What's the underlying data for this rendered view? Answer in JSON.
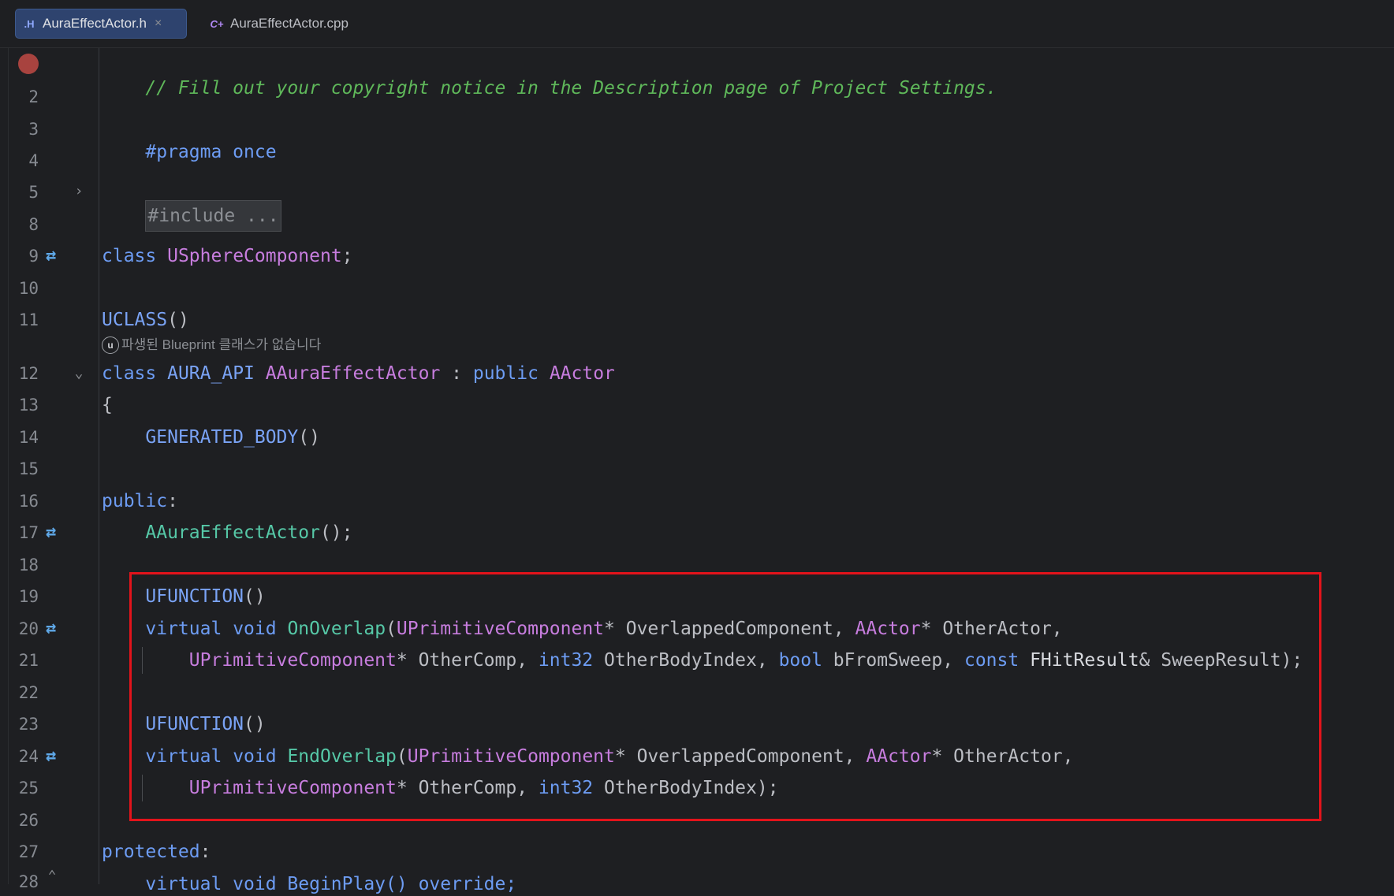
{
  "tabs": [
    {
      "icon": ".H",
      "label": "AuraEffectActor.h",
      "close": "×",
      "active": true
    },
    {
      "icon": "C+",
      "label": "AuraEffectActor.cpp",
      "active": false
    }
  ],
  "line_numbers": [
    "2",
    "3",
    "4",
    "5",
    "8",
    "9",
    "10",
    "11",
    "12",
    "13",
    "14",
    "15",
    "16",
    "17",
    "18",
    "19",
    "20",
    "21",
    "22",
    "23",
    "24",
    "25",
    "26",
    "27",
    "28"
  ],
  "code": {
    "comment": "// Fill out your copyright notice in the Description page of Project Settings.",
    "pragma": "#pragma once",
    "include_folded": "#include ...",
    "class_kw": "class",
    "usphere": "USphereComponent",
    "semi": ";",
    "uclass": "UCLASS",
    "parens": "()",
    "blueprint_hint": "파생된 Blueprint 클래스가 없습니다",
    "aura_api": "AURA_API",
    "aaura": "AAuraEffectActor",
    "colon": " : ",
    "public_kw": "public",
    "aactor": "AActor",
    "open_brace": "{",
    "generated_body": "GENERATED_BODY",
    "public_label": "public",
    "ctor": "AAuraEffectActor",
    "ctor_tail": "();",
    "ufunction": "UFUNCTION",
    "virtual": "virtual",
    "void": "void",
    "on_overlap": "OnOverlap",
    "end_overlap": "EndOverlap",
    "uprim": "UPrimitiveComponent",
    "ptr_overlapped": "* OverlappedComponent, ",
    "ptr_other_actor": "* OtherActor,",
    "ptr_other_comp": "* OtherComp, ",
    "int32": "int32",
    "other_body_index_comma": " OtherBodyIndex, ",
    "other_body_index_end": " OtherBodyIndex);",
    "bool": "bool",
    "bfromsweep": " bFromSweep, ",
    "const": "const",
    "fhitresult": "FHitResult",
    "sweepresult": "& SweepResult);",
    "protected_label": "protected",
    "begin_play_line": "    virtual void BeginPlay() override;"
  },
  "gutter_icons": [
    "breakpoint",
    "implements-icon"
  ],
  "colors": {
    "background": "#1e1f22",
    "comment": "#5fb85a",
    "keyword": "#6d9cf3",
    "type": "#c77dde",
    "function": "#56c8a7",
    "highlight_box": "#e3131b",
    "breakpoint": "#a8433f"
  }
}
